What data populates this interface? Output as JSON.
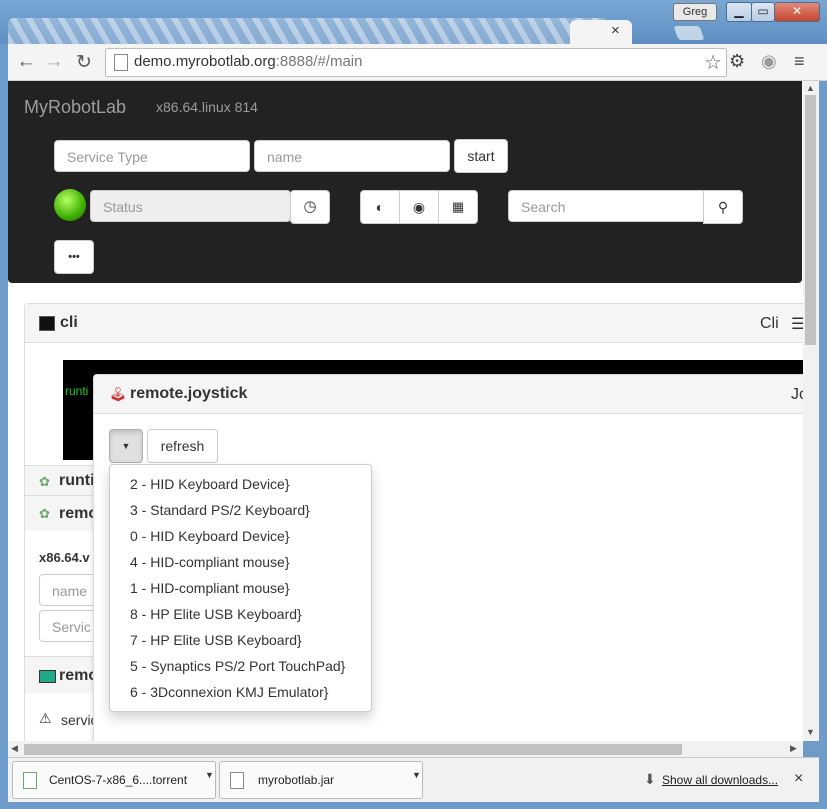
{
  "browser": {
    "user": "Greg",
    "tab_close": "×",
    "url_host": "demo.myrobotlab.org",
    "url_rest": ":8888/#/main"
  },
  "navbar": {
    "brand": "MyRobotLab",
    "platform": "x86.64.linux 814",
    "service_type_placeholder": "Service Type",
    "name_placeholder": "name",
    "start_label": "start",
    "status_placeholder": "Status",
    "search_placeholder": "Search",
    "more_label": "•••"
  },
  "panels": {
    "cli": {
      "title": "cli",
      "type_label": "Cli",
      "terminal_text": "runti"
    },
    "runtime_partial": "runti",
    "remote1_partial": "remo",
    "platform_partial": "x86.64.v",
    "name_placeholder": "name",
    "service_placeholder": "Servic",
    "remote2_partial": "remo",
    "service_partial": "servic"
  },
  "joystick": {
    "title": "remote.joystick",
    "type_label": "Jo",
    "refresh_label": "refresh",
    "controllers": [
      "2 - HID Keyboard Device}",
      "3 - Standard PS/2 Keyboard}",
      "0 - HID Keyboard Device}",
      "4 - HID-compliant mouse}",
      "1 - HID-compliant mouse}",
      "8 - HP Elite USB Keyboard}",
      "7 - HP Elite USB Keyboard}",
      "5 - Synaptics PS/2 Port TouchPad}",
      "6 - 3Dconnexion KMJ Emulator}"
    ]
  },
  "downloads": {
    "items": [
      "CentOS-7-x86_6....torrent",
      "myrobotlab.jar"
    ],
    "show_all": "Show all downloads...",
    "close": "×"
  }
}
